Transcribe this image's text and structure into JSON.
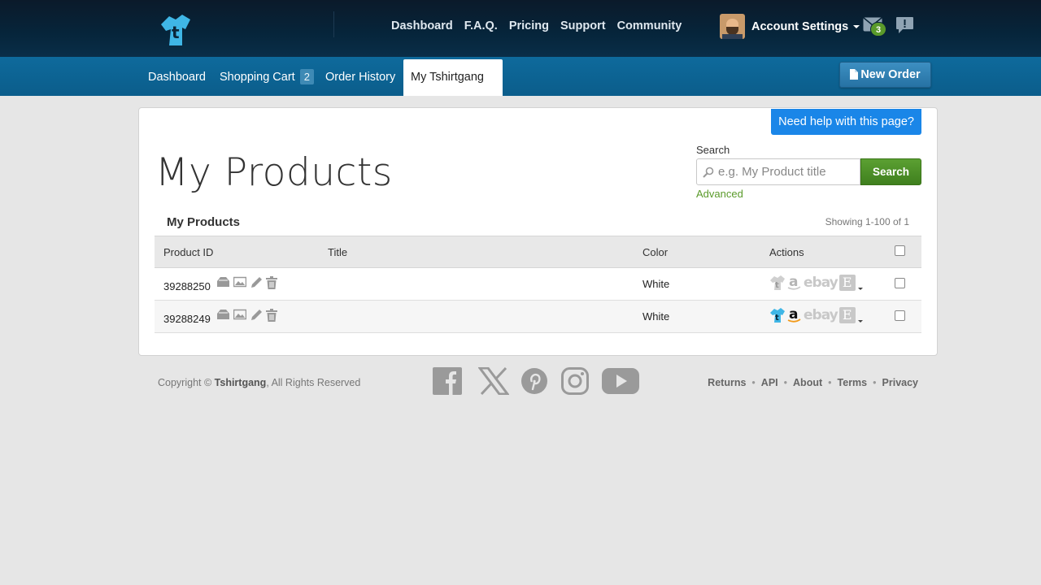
{
  "topbar": {
    "nav": [
      "Dashboard",
      "F.A.Q.",
      "Pricing",
      "Support",
      "Community"
    ],
    "account_label": "Account Settings",
    "mail_count": "3"
  },
  "subnav": {
    "dashboard": "Dashboard",
    "cart": "Shopping Cart",
    "cart_count": "2",
    "order_history": "Order History",
    "my_brand": "My Tshirtgang",
    "new_order": "New Order"
  },
  "panel": {
    "help": "Need help with this page?",
    "title": "My Products",
    "search_label": "Search",
    "search_placeholder": "e.g. My Product title",
    "search_button": "Search",
    "advanced": "Advanced",
    "section_title": "My Products",
    "showing": "Showing 1-100 of 1"
  },
  "table": {
    "columns": [
      "Product ID",
      "Title",
      "Color",
      "Actions"
    ],
    "rows": [
      {
        "id": "39288250",
        "title": "",
        "color": "White",
        "tshirtgang_active": false,
        "amazon_active": false
      },
      {
        "id": "39288249",
        "title": "",
        "color": "White",
        "tshirtgang_active": true,
        "amazon_active": true
      }
    ],
    "marketplace_labels": {
      "ebay": "ebay",
      "etsy": "E"
    }
  },
  "footer": {
    "copyright_prefix": "Copyright © ",
    "brand": "Tshirtgang",
    "copyright_suffix": ", All Rights Reserved",
    "links": [
      "Returns",
      "API",
      "About",
      "Terms",
      "Privacy"
    ]
  },
  "colors": {
    "topbar": "#06253b",
    "subnav": "#0e6a9c",
    "search_button": "#4a8e26",
    "help_button": "#1a86e8",
    "brand_cyan": "#3fb6e6"
  },
  "icons": [
    "logo-icon",
    "mail-icon",
    "alert-icon",
    "document-icon",
    "search-icon",
    "shirt-icon",
    "image-icon",
    "pencil-icon",
    "trash-icon",
    "facebook-icon",
    "x-icon",
    "pinterest-icon",
    "instagram-icon",
    "youtube-icon"
  ]
}
